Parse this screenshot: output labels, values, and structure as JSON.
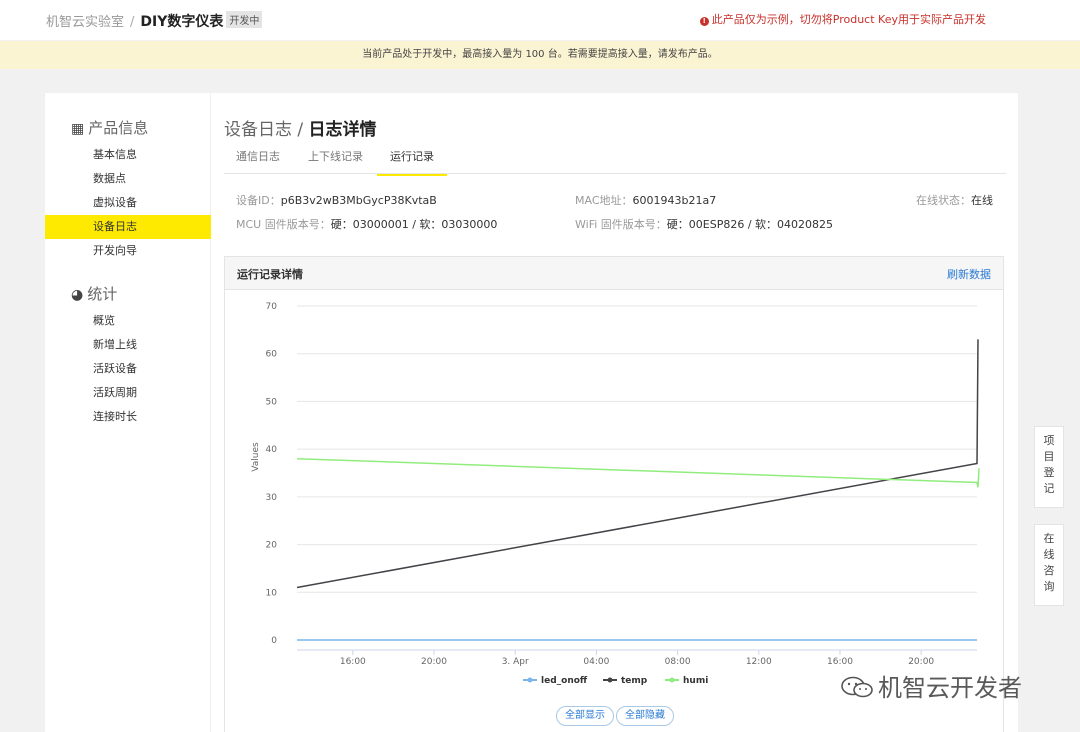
{
  "header": {
    "lab": "机智云实验室",
    "separator": "/",
    "product": "DIY数字仪表",
    "tag": "开发中",
    "warning": "此产品仅为示例，切勿将Product Key用于实际产品开发",
    "warning_color": "#c8312b"
  },
  "notice": "当前产品处于开发中，最高接入量为 100 台。若需要提高接入量，请发布产品。",
  "sidebar": {
    "section1": {
      "title": "产品信息",
      "icon": "grid-icon"
    },
    "items1": [
      "基本信息",
      "数据点",
      "虚拟设备",
      "设备日志",
      "开发向导"
    ],
    "active_item": "设备日志",
    "section2": {
      "title": "统计",
      "icon": "pie-icon"
    },
    "items2": [
      "概览",
      "新增上线",
      "活跃设备",
      "活跃周期",
      "连接时长"
    ]
  },
  "page": {
    "title_parent": "设备日志 /",
    "title_current": "日志详情",
    "tabs": [
      "通信日志",
      "上下线记录",
      "运行记录"
    ],
    "active_tab": "运行记录"
  },
  "device": {
    "id_label": "设备ID：",
    "id_value": "p6B3v2wB3MbGycP38KvtaB",
    "mac_label": "MAC地址：",
    "mac_value": "6001943b21a7",
    "status_label": "在线状态：",
    "status_value": "在线",
    "mcu_label": "MCU 固件版本号：",
    "mcu_value": "硬：03000001 / 软：03030000",
    "wifi_label": "WiFi 固件版本号：",
    "wifi_value": "硬：00ESP826 / 软：04020825"
  },
  "card": {
    "title": "运行记录详情",
    "refresh": "刷新数据",
    "show_all": "全部显示",
    "hide_all": "全部隐藏"
  },
  "float_tabs": [
    "项目登记",
    "在线咨询"
  ],
  "watermark": "机智云开发者",
  "chart_data": {
    "type": "line",
    "ylabel": "Values",
    "ylim": [
      0,
      70
    ],
    "yticks": [
      0,
      10,
      20,
      30,
      40,
      50,
      60,
      70
    ],
    "xticks": [
      "16:00",
      "20:00",
      "3. Apr",
      "04:00",
      "08:00",
      "12:00",
      "16:00",
      "20:00"
    ],
    "xrange_hours": [
      13.25,
      46.75
    ],
    "grid": true,
    "legend_position": "bottom",
    "series": [
      {
        "name": "led_onoff",
        "color": "#7cb5ec",
        "points": [
          [
            13.25,
            0
          ],
          [
            46.75,
            0
          ]
        ]
      },
      {
        "name": "temp",
        "color": "#434348",
        "points": [
          [
            13.25,
            11
          ],
          [
            46.75,
            37
          ],
          [
            46.8,
            63
          ]
        ]
      },
      {
        "name": "humi",
        "color": "#90ed7d",
        "points": [
          [
            13.25,
            38
          ],
          [
            46.75,
            33
          ],
          [
            46.8,
            32
          ],
          [
            46.85,
            36
          ]
        ]
      }
    ]
  }
}
